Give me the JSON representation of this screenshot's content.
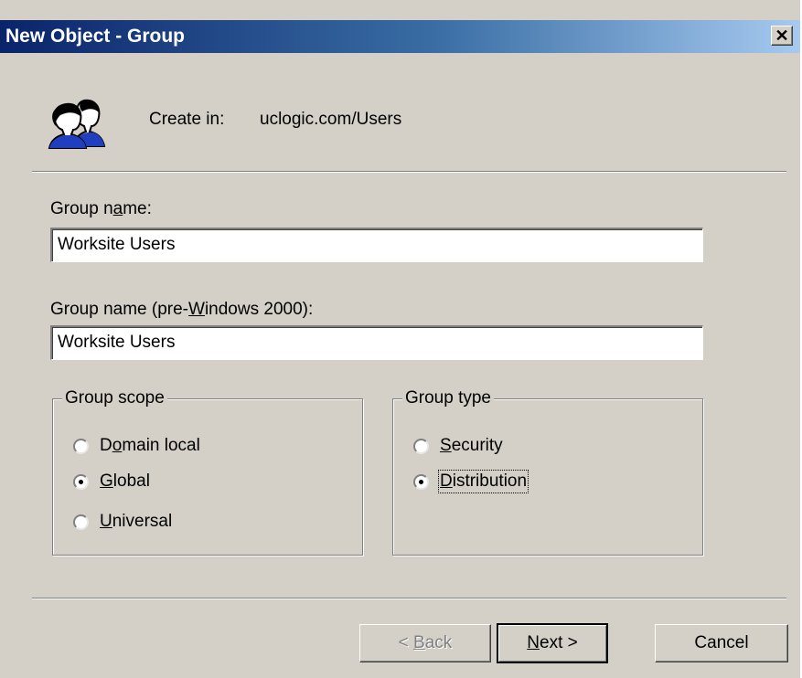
{
  "window": {
    "title": "New Object - Group",
    "close_glyph": "✕"
  },
  "header": {
    "create_in_label": "Create in:",
    "create_in_value": "uclogic.com/Users",
    "icon": "group-users-icon"
  },
  "fields": {
    "group_name": {
      "label_pre": "Group n",
      "label_u": "a",
      "label_post": "me:",
      "value": "Worksite Users"
    },
    "group_name_pre2000": {
      "label_pre": "Group name (pre-",
      "label_u": "W",
      "label_post": "indows 2000):",
      "value": "Worksite Users"
    }
  },
  "group_scope": {
    "title": "Group scope",
    "options": [
      {
        "pre": "D",
        "u": "o",
        "post": "main local",
        "selected": false
      },
      {
        "pre": "",
        "u": "G",
        "post": "lobal",
        "selected": true
      },
      {
        "pre": "",
        "u": "U",
        "post": "niversal",
        "selected": false
      }
    ]
  },
  "group_type": {
    "title": "Group type",
    "options": [
      {
        "pre": "",
        "u": "S",
        "post": "ecurity",
        "selected": false
      },
      {
        "pre": "",
        "u": "D",
        "post": "istribution",
        "selected": true
      }
    ]
  },
  "buttons": {
    "back": {
      "pre": "< ",
      "u": "B",
      "post": "ack",
      "enabled": false
    },
    "next": {
      "pre": "",
      "u": "N",
      "post": "ext >",
      "enabled": true
    },
    "cancel": {
      "label": "Cancel",
      "enabled": true
    }
  }
}
